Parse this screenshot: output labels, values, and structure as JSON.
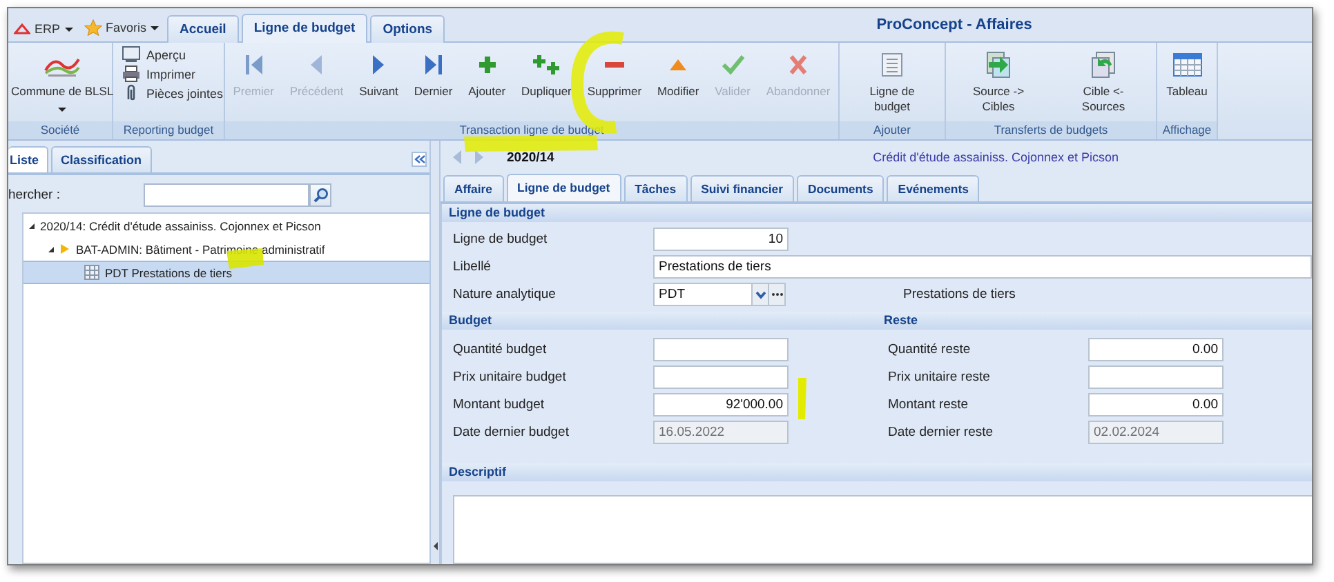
{
  "header": {
    "quick_menus": [
      {
        "label": "ERP"
      },
      {
        "label": "Favoris"
      }
    ],
    "tabs": [
      {
        "label": "Accueil",
        "selected": false
      },
      {
        "label": "Ligne de budget",
        "selected": true
      },
      {
        "label": "Options",
        "selected": false
      }
    ],
    "title": "ProConcept - Affaires"
  },
  "ribbon": {
    "groups": [
      {
        "label": "Société",
        "kind": "large",
        "buttons": [
          {
            "label": "Commune de BLSL",
            "disabled": false,
            "dropdown": true
          }
        ]
      },
      {
        "label": "Reporting budget",
        "kind": "small",
        "buttons": [
          {
            "label": "Aperçu"
          },
          {
            "label": "Imprimer"
          },
          {
            "label": "Pièces jointes"
          }
        ]
      },
      {
        "label": "Transaction ligne de budget",
        "kind": "large",
        "buttons": [
          {
            "label": "Premier",
            "disabled": true
          },
          {
            "label": "Précédent",
            "disabled": true
          },
          {
            "label": "Suivant",
            "disabled": false
          },
          {
            "label": "Dernier",
            "disabled": false
          },
          {
            "label": "Ajouter",
            "disabled": false
          },
          {
            "label": "Dupliquer",
            "disabled": false
          },
          {
            "label": "Supprimer",
            "disabled": false
          },
          {
            "label": "Modifier",
            "disabled": false
          },
          {
            "label": "Valider",
            "disabled": true
          },
          {
            "label": "Abandonner",
            "disabled": true
          }
        ]
      },
      {
        "label": "Ajouter",
        "kind": "large",
        "buttons": [
          {
            "label": "Ligne de budget",
            "disabled": false
          }
        ]
      },
      {
        "label": "Transferts de budgets",
        "kind": "large",
        "buttons": [
          {
            "label": "Source -> Cibles",
            "disabled": false
          },
          {
            "label": "Cible <- Sources",
            "disabled": false
          }
        ]
      },
      {
        "label": "Affichage",
        "kind": "large",
        "buttons": [
          {
            "label": "Tableau",
            "disabled": false
          }
        ]
      }
    ]
  },
  "sidebar": {
    "tabs": [
      {
        "label": "Liste",
        "selected": true
      },
      {
        "label": "Classification",
        "selected": false
      }
    ],
    "search": {
      "label": "hercher :"
    },
    "tree": [
      {
        "label": "2020/14: Crédit d'étude assainiss. Cojonnex et Picson",
        "expanded": true,
        "selected": false,
        "children": [
          {
            "label": "BAT-ADMIN: Bâtiment - Patrimoine administratif",
            "kind": "folder",
            "expanded": true,
            "selected": false,
            "children": [
              {
                "label": "PDT Prestations de tiers",
                "kind": "line",
                "selected": true
              }
            ]
          }
        ]
      }
    ]
  },
  "detail": {
    "record": "2020/14",
    "subtitle": "Crédit d'étude assainiss. Cojonnex et Picson",
    "tabs": [
      {
        "label": "Affaire",
        "selected": false
      },
      {
        "label": "Ligne de budget",
        "selected": true
      },
      {
        "label": "Tâches",
        "selected": false
      },
      {
        "label": "Suivi financier",
        "selected": false
      },
      {
        "label": "Documents",
        "selected": false
      },
      {
        "label": "Evénements",
        "selected": false
      }
    ],
    "line_section": {
      "title": "Ligne de budget",
      "fields": [
        {
          "label": "Ligne de budget",
          "value": "10",
          "kind": "number"
        },
        {
          "label": "Libellé",
          "value": "Prestations de tiers",
          "kind": "text"
        },
        {
          "label": "Nature analytique",
          "value": "PDT",
          "kind": "combo",
          "description": "Prestations de tiers"
        }
      ]
    },
    "budget_section": {
      "title": "Budget",
      "fields": [
        {
          "label": "Quantité budget",
          "disabled": false
        },
        {
          "label": "Prix unitaire budget",
          "disabled": false
        },
        {
          "label": "Montant budget",
          "value": "92'000.00",
          "disabled": false
        },
        {
          "label": "Date dernier budget",
          "value": "16.05.2022",
          "disabled": true
        }
      ]
    },
    "rest_section": {
      "title": "Reste",
      "fields": [
        {
          "label": "Quantité reste",
          "value": "0.00",
          "disabled": false
        },
        {
          "label": "Prix unitaire reste",
          "disabled": false
        },
        {
          "label": "Montant reste",
          "value": "0.00",
          "disabled": false
        },
        {
          "label": "Date dernier reste",
          "value": "02.02.2024",
          "disabled": true
        }
      ]
    },
    "description_section": {
      "title": "Descriptif"
    }
  }
}
